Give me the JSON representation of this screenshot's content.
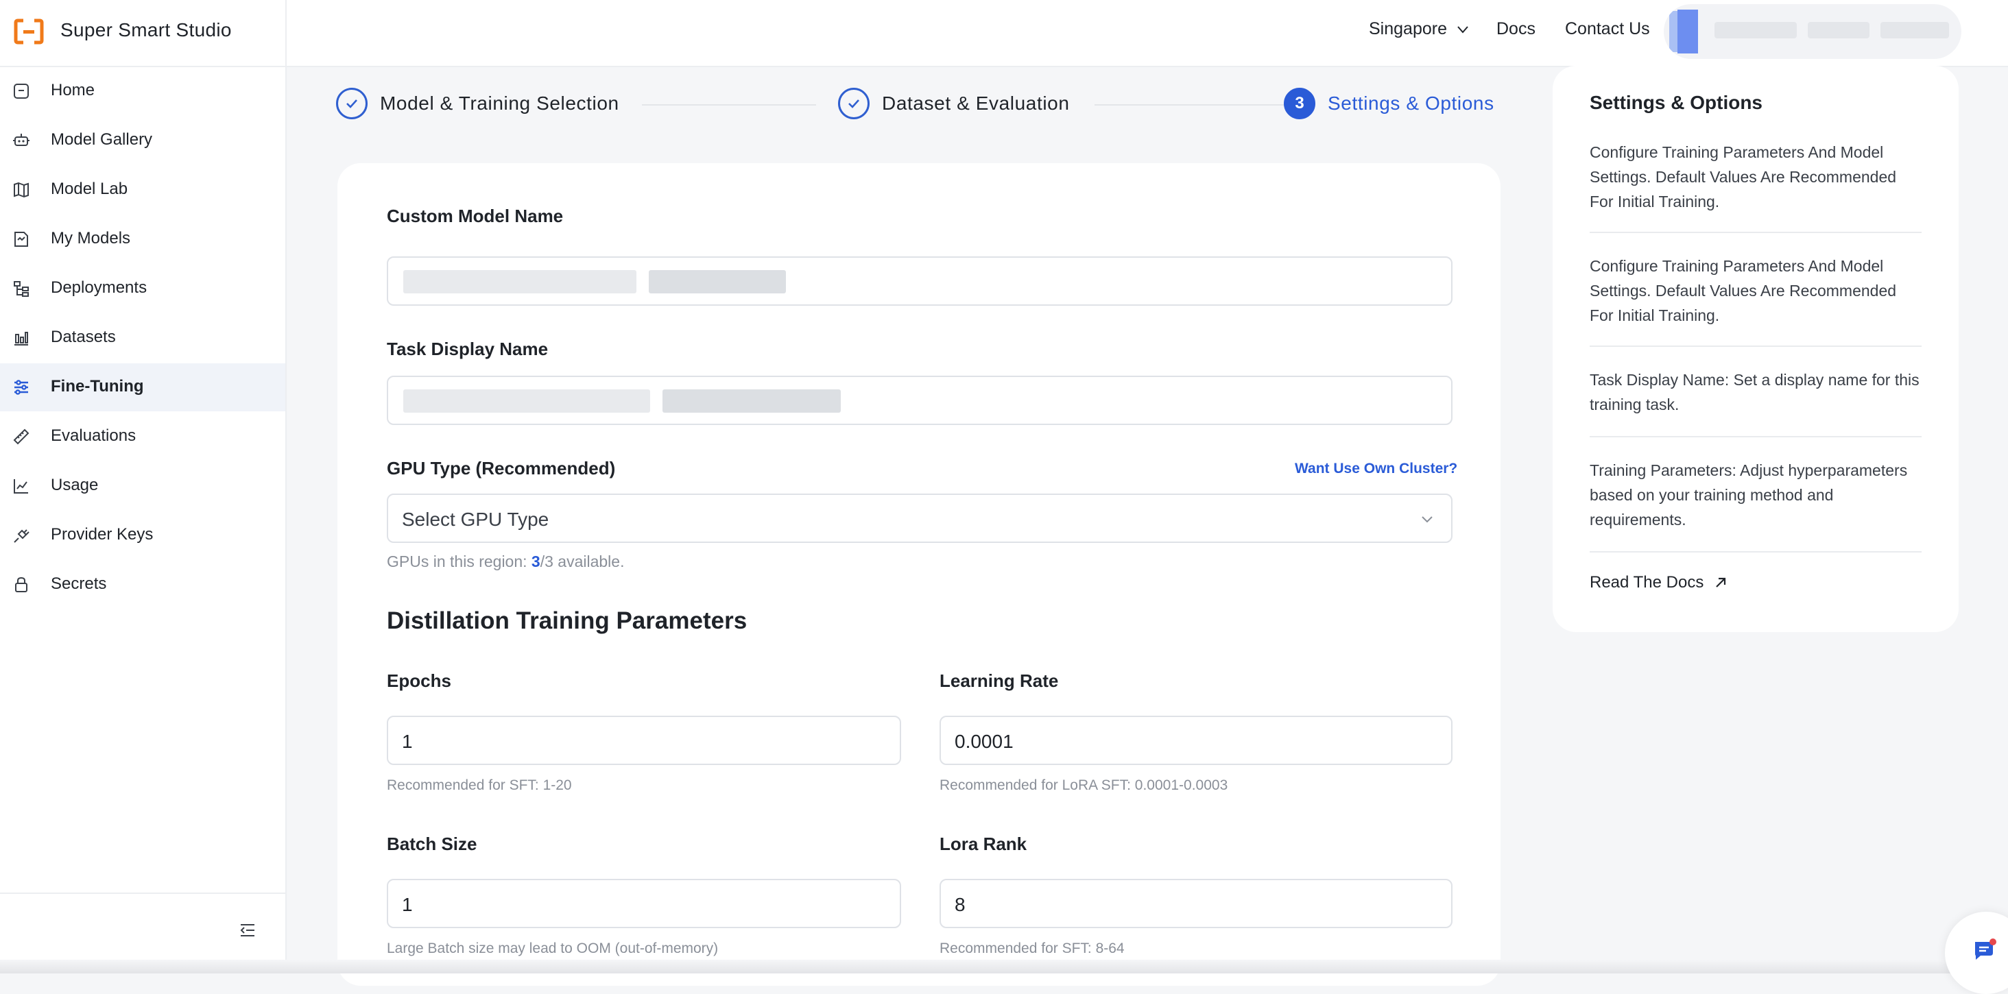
{
  "app": {
    "name": "Super Smart Studio"
  },
  "header": {
    "region": "Singapore",
    "docs": "Docs",
    "contact": "Contact Us"
  },
  "sidebar": {
    "items": [
      {
        "label": "Home",
        "icon": "home-icon"
      },
      {
        "label": "Model Gallery",
        "icon": "robot-icon"
      },
      {
        "label": "Model Lab",
        "icon": "map-icon"
      },
      {
        "label": "My Models",
        "icon": "model-file-icon"
      },
      {
        "label": "Deployments",
        "icon": "deploy-tree-icon"
      },
      {
        "label": "Datasets",
        "icon": "bar-chart-icon"
      },
      {
        "label": "Fine-Tuning",
        "icon": "sliders-icon",
        "active": true
      },
      {
        "label": "Evaluations",
        "icon": "ruler-icon"
      },
      {
        "label": "Usage",
        "icon": "usage-chart-icon"
      },
      {
        "label": "Provider Keys",
        "icon": "plug-icon"
      },
      {
        "label": "Secrets",
        "icon": "lock-icon"
      }
    ]
  },
  "steps": [
    {
      "label": "Model & Training Selection",
      "status": "done"
    },
    {
      "label": "Dataset & Evaluation",
      "status": "done"
    },
    {
      "number": "3",
      "label": "Settings & Options",
      "status": "active"
    }
  ],
  "form": {
    "custom_model_name_label": "Custom Model Name",
    "task_display_name_label": "Task Display Name",
    "gpu_label": "GPU Type (Recommended)",
    "own_cluster_link": "Want Use Own Cluster?",
    "gpu_placeholder": "Select GPU Type",
    "gpu_region_prefix": "GPUs in this region: ",
    "gpu_available": "3",
    "gpu_region_suffix": "/3 available.",
    "section_title": "Distillation Training Parameters",
    "epochs_label": "Epochs",
    "epochs_value": "1",
    "epochs_hint": "Recommended for SFT: 1-20",
    "lr_label": "Learning Rate",
    "lr_value": "0.0001",
    "lr_hint": "Recommended for LoRA SFT: 0.0001-0.0003",
    "batch_label": "Batch Size",
    "batch_value": "1",
    "batch_hint": "Large Batch size may lead to OOM (out-of-memory)",
    "rank_label": "Lora Rank",
    "rank_value": "8",
    "rank_hint": "Recommended for SFT: 8-64"
  },
  "help_panel": {
    "title": "Settings & Options",
    "paragraphs": [
      "Configure Training Parameters And Model Settings. Default Values Are Recommended For Initial Training.",
      "Configure Training Parameters And Model Settings. Default Values Are Recommended For Initial Training.",
      "Task Display Name: Set a display name for this training task.",
      "Training Parameters: Adjust hyperparameters based on your training method and requirements."
    ],
    "docs_link": "Read The Docs"
  },
  "colors": {
    "accent": "#2a5bd7",
    "brand": "#f07a1a"
  }
}
